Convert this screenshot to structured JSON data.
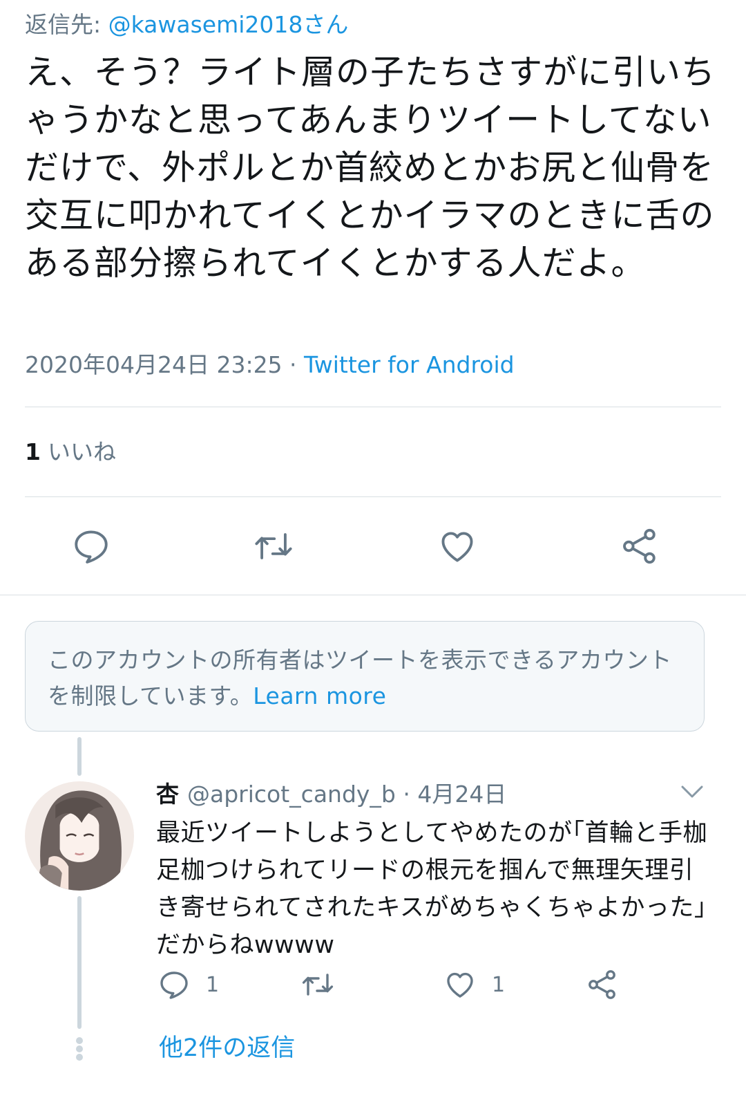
{
  "main_tweet": {
    "reply_prefix": "返信先: ",
    "reply_handle": "@kawasemi2018さん",
    "text": "え、そう？ライト層の子たちさすがに引いちゃうかなと思ってあんまりツイートしてないだけで、外ポルとか首絞めとかお尻と仙骨を交互に叩かれてイくとかイラマのときに舌のある部分擦られてイくとかする人だよ。",
    "timestamp": "2020年04月24日 23:25",
    "separator": " · ",
    "source": "Twitter for Android",
    "like_count": "1",
    "like_label": "いいね"
  },
  "main_actions": {
    "icons": [
      "reply-icon",
      "retweet-icon",
      "like-icon",
      "share-icon"
    ]
  },
  "notice": {
    "text": "このアカウントの所有者はツイートを表示できるアカウントを制限しています。",
    "link": "Learn more"
  },
  "reply_tweet": {
    "name": "杏",
    "handle": "@apricot_candy_b",
    "separator": " · ",
    "date": "4月24日",
    "text": "最近ツイートしようとしてやめたのが｢首輪と手枷足枷つけられてリードの根元を掴んで無理矢理引き寄せられてされたキスがめちゃくちゃよかった｣だからねwwww",
    "reply_count": "1",
    "like_count": "1",
    "more_replies": "他2件の返信"
  },
  "colors": {
    "text": "#14171a",
    "muted": "#657786",
    "link": "#1b95e0",
    "divider": "#d9dfe3",
    "notice_bg": "#f5f8fa"
  }
}
